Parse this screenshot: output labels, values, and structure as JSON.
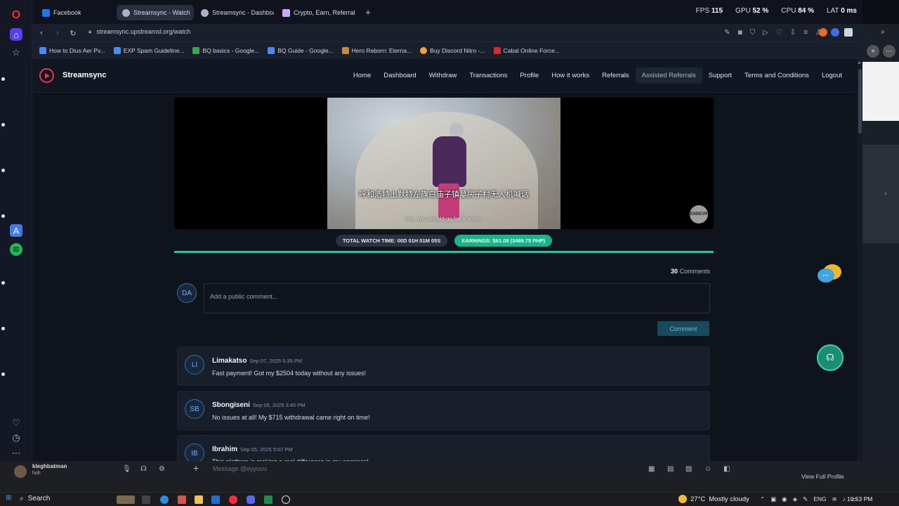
{
  "browser": {
    "tabs": [
      {
        "label": "Facebook",
        "color": "#1877f2",
        "active": false
      },
      {
        "label": "Streamsync - Watch",
        "color": "#aab2c4",
        "active": true
      },
      {
        "label": "Streamsync - Dashboard",
        "color": "#aab2c4",
        "active": false
      },
      {
        "label": "Crypto, Earn, Referrals",
        "color": "#c9a8ff",
        "active": false
      }
    ],
    "perf": {
      "fps_label": "FPS",
      "fps": "115",
      "gpu_label": "GPU",
      "gpu": "52 %",
      "cpu_label": "CPU",
      "cpu": "84 %",
      "lat_label": "LAT",
      "lat": "0 ms"
    },
    "url": "streamsync.upstreamsl.org/watch",
    "bookmarks": [
      {
        "label": "How to Dius Aer Pv...",
        "color": "#4a8af4"
      },
      {
        "label": "EXP Spam Guideline...",
        "color": "#4a8af4"
      },
      {
        "label": "BQ basics - Google...",
        "color": "#34a853"
      },
      {
        "label": "BQ Guide - Google...",
        "color": "#4a8af4"
      },
      {
        "label": "Hero Reborn: Eterna...",
        "color": "#c98b3a"
      },
      {
        "label": "Buy Discord Nitro -...",
        "color": "#f3a23b"
      },
      {
        "label": "Cabal Online Force...",
        "color": "#e0262e"
      }
    ]
  },
  "site": {
    "brand": "Streamsync",
    "nav": [
      "Home",
      "Dashboard",
      "Withdraw",
      "Transactions",
      "Profile",
      "How it works",
      "Referrals",
      "Assisted Referrals",
      "Support",
      "Terms and Conditions",
      "Logout"
    ],
    "nav_highlight": "Assisted Referrals",
    "video": {
      "subtitle_cn": "呼和浩特土默特左旗白庙子镇墓房子村无人机喊话",
      "subtitle_en": "Yes, you should go back home.",
      "watermark": "ENDEVR"
    },
    "stats": {
      "watch_time": "TOTAL WATCH TIME: 00D 01H 01M 05S",
      "earnings": "EARNINGS: $61.08 (3489.75 PHP)"
    },
    "progress_pct": 100,
    "comments": {
      "count": "30",
      "count_label": "Comments",
      "user_initials": "DA",
      "placeholder": "Add a public comment...",
      "button": "Comment",
      "items": [
        {
          "initials": "LI",
          "name": "Limakatso",
          "date": "Sep 07, 2025 5:35 PM",
          "text": "Fast payment! Got my $2504 today without any issues!"
        },
        {
          "initials": "SB",
          "name": "Sbongiseni",
          "date": "Sep 06, 2025 3:45 PM",
          "text": "No issues at all! My $715 withdrawal came right on time!"
        },
        {
          "initials": "IB",
          "name": "Ibrahim",
          "date": "Sep 05, 2025 5:07 PM",
          "text": "This platform is making a real difference in my earnings!"
        }
      ]
    }
  },
  "discord": {
    "username": "kleghbatman",
    "status": "huh",
    "message_placeholder": "Message @eyyuuu",
    "view_profile": "View Full Profile"
  },
  "taskbar": {
    "search": "Search",
    "weather_temp": "27°C",
    "weather_desc": "Mostly cloudy",
    "lang": "ENG",
    "time": "10:53 PM"
  },
  "colors": {
    "accent": "#22c9a0",
    "brand_red": "#e23a48"
  }
}
